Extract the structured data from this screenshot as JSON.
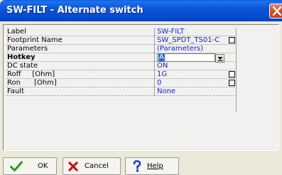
{
  "window": {
    "title": "SW-FILT - Alternate switch"
  },
  "properties": [
    {
      "label": "Label",
      "value": "SW-FILT",
      "checkbox": false,
      "bold": false
    },
    {
      "label": "Footprint Name",
      "value": "SW_SPDT_TS01-C",
      "checkbox": true,
      "bold": false
    },
    {
      "label": "Parameters",
      "value": "(Parameters)",
      "checkbox": false,
      "bold": false
    },
    {
      "label": "Hotkey",
      "value": "A",
      "checkbox": false,
      "bold": true,
      "editing": true
    },
    {
      "label": "DC state",
      "value": "ON",
      "checkbox": false,
      "bold": false
    },
    {
      "label": "Roff     [Ohm]",
      "value": "1G",
      "checkbox": true,
      "bold": false
    },
    {
      "label": "Ron      [Ohm]",
      "value": "0",
      "checkbox": true,
      "bold": false
    },
    {
      "label": "Fault",
      "value": "None",
      "checkbox": false,
      "bold": false
    }
  ],
  "buttons": {
    "ok": "OK",
    "cancel": "Cancel",
    "help": "Help"
  },
  "colors": {
    "value_text": "#1a22c8",
    "title_bar": "#0449cc",
    "ok_check": "#2a9a2a",
    "cancel_x": "#c81818",
    "help_mark": "#1a3fcc"
  }
}
